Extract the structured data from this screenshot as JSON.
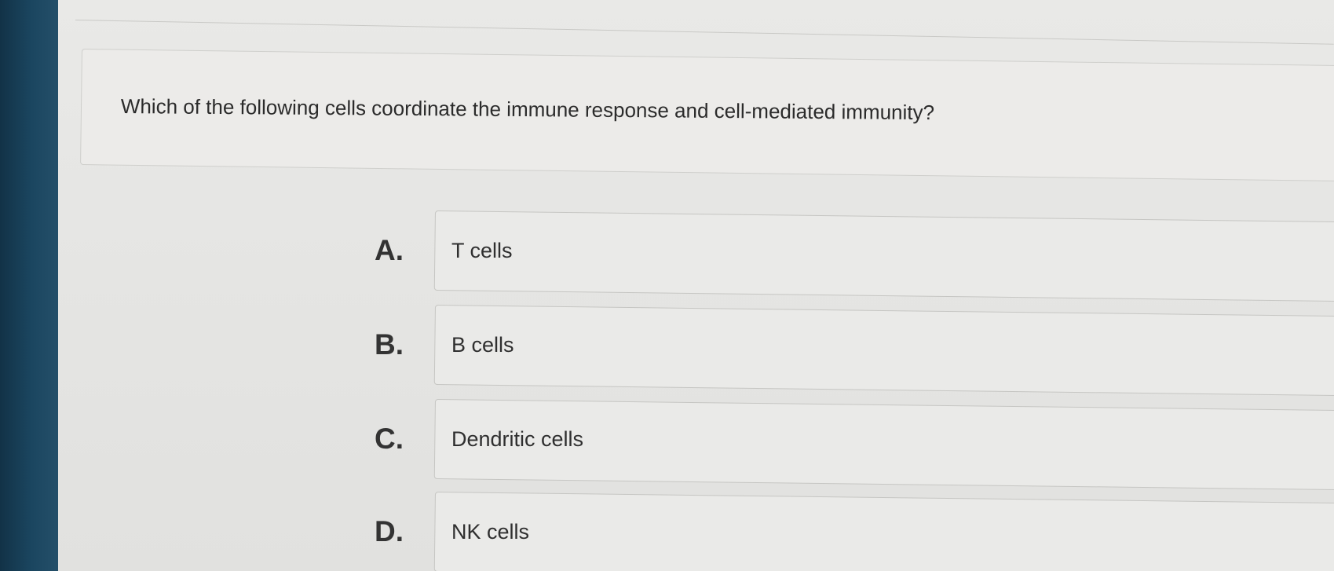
{
  "question": {
    "text": "Which of the following cells coordinate the immune response and cell-mediated immunity?"
  },
  "options": [
    {
      "letter": "A.",
      "text": "T cells"
    },
    {
      "letter": "B.",
      "text": "B cells"
    },
    {
      "letter": "C.",
      "text": "Dendritic cells"
    },
    {
      "letter": "D.",
      "text": "NK cells"
    }
  ]
}
